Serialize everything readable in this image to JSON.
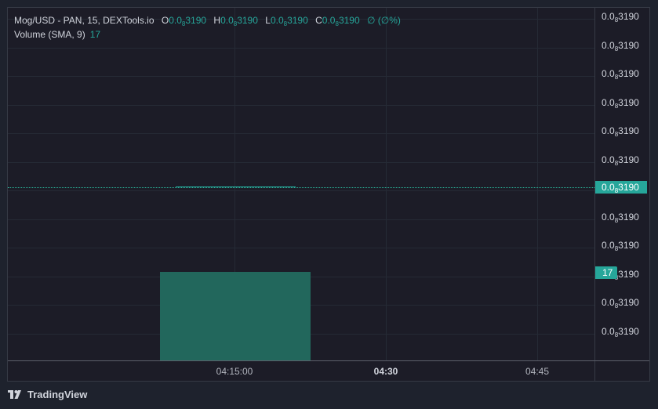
{
  "legend": {
    "symbol": "Mog/USD - PAN, 15, DEXTools.io",
    "open_key": "O",
    "open_main": "0.0",
    "open_sub": "8",
    "open_tail": "3190",
    "high_key": "H",
    "high_main": "0.0",
    "high_sub": "8",
    "high_tail": "3190",
    "low_key": "L",
    "low_main": "0.0",
    "low_sub": "8",
    "low_tail": "3190",
    "close_key": "C",
    "close_main": "0.0",
    "close_sub": "8",
    "close_tail": "3190",
    "change": "∅ (∅%)",
    "volume_label": "Volume (SMA, 9)",
    "volume_value": "17"
  },
  "price_axis": {
    "tick_main": "0.0",
    "tick_sub": "8",
    "tick_tail": "3190",
    "tick_count": 12,
    "current_price_main": "0.0",
    "current_price_sub": "8",
    "current_price_tail": "3190",
    "volume_badge": "17"
  },
  "time_axis": {
    "labels": [
      "04:15:00",
      "04:30",
      "04:45"
    ]
  },
  "footer": {
    "brand": "TradingView"
  },
  "colors": {
    "up": "#26a69a",
    "background": "#1c1c27",
    "volume": "#22675c"
  }
}
